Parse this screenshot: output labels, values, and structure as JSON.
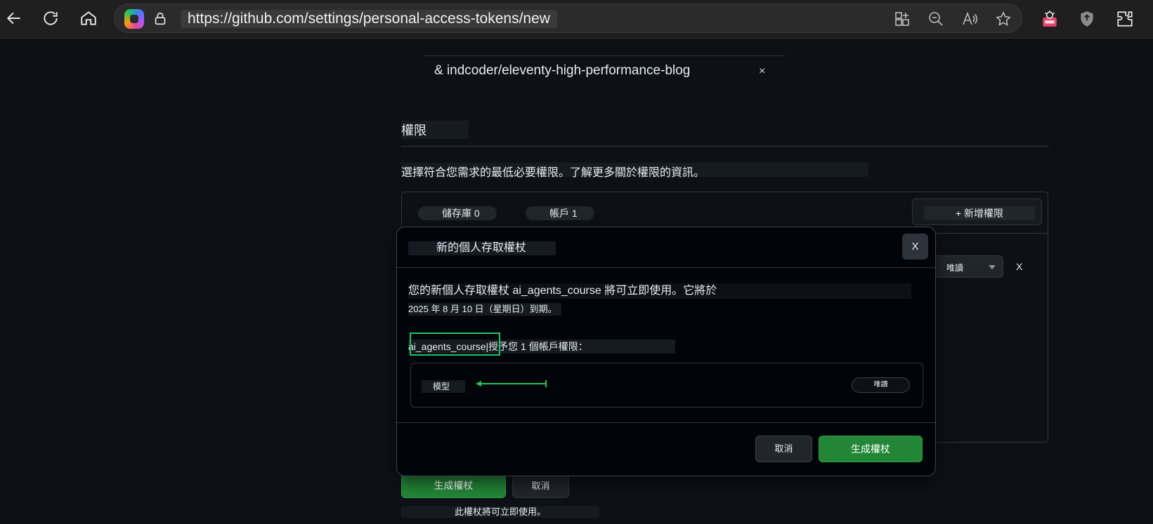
{
  "browser": {
    "url": "https://github.com/settings/personal-access-tokens/new",
    "buttons": [
      "back-icon",
      "refresh-icon",
      "home-icon"
    ],
    "address_icons": [
      "split-screen-icon",
      "zoom-out-icon",
      "read-aloud-icon",
      "favorite-star-icon"
    ],
    "extensions": [
      "image-extension-icon",
      "shield-extension-icon",
      "extensions-puzzle-icon"
    ]
  },
  "page": {
    "repo_item": "& indcoder/eleventy-high-performance-blog",
    "repo_remove": "×",
    "permissions_title": "權限",
    "permissions_desc": "選擇符合您需求的最低必要權限。了解更多關於權限的資訊。",
    "tab_repositories": "儲存庫 0",
    "tab_account": "帳戶 1",
    "add_permission": "+ 新增權限",
    "select_value": "唯讀",
    "row_remove": "X",
    "generate_button": "生成權杖",
    "cancel_button": "取消",
    "note": "此權杖將可立即使用。"
  },
  "modal": {
    "title": "新的個人存取權杖",
    "close": "X",
    "line1": "您的新個人存取權杖 ai_agents_course 將可立即使用。它將於",
    "line2": "2025 年 8 月 10 日（星期日）到期。",
    "token_name": "ai_agents_course",
    "grant_text": "|授予您 1 個帳戶權限：",
    "permission_name": "模型",
    "permission_level": "唯讀",
    "cancel": "取消",
    "generate": "生成權杖",
    "highlight_color": "#22c55e"
  }
}
